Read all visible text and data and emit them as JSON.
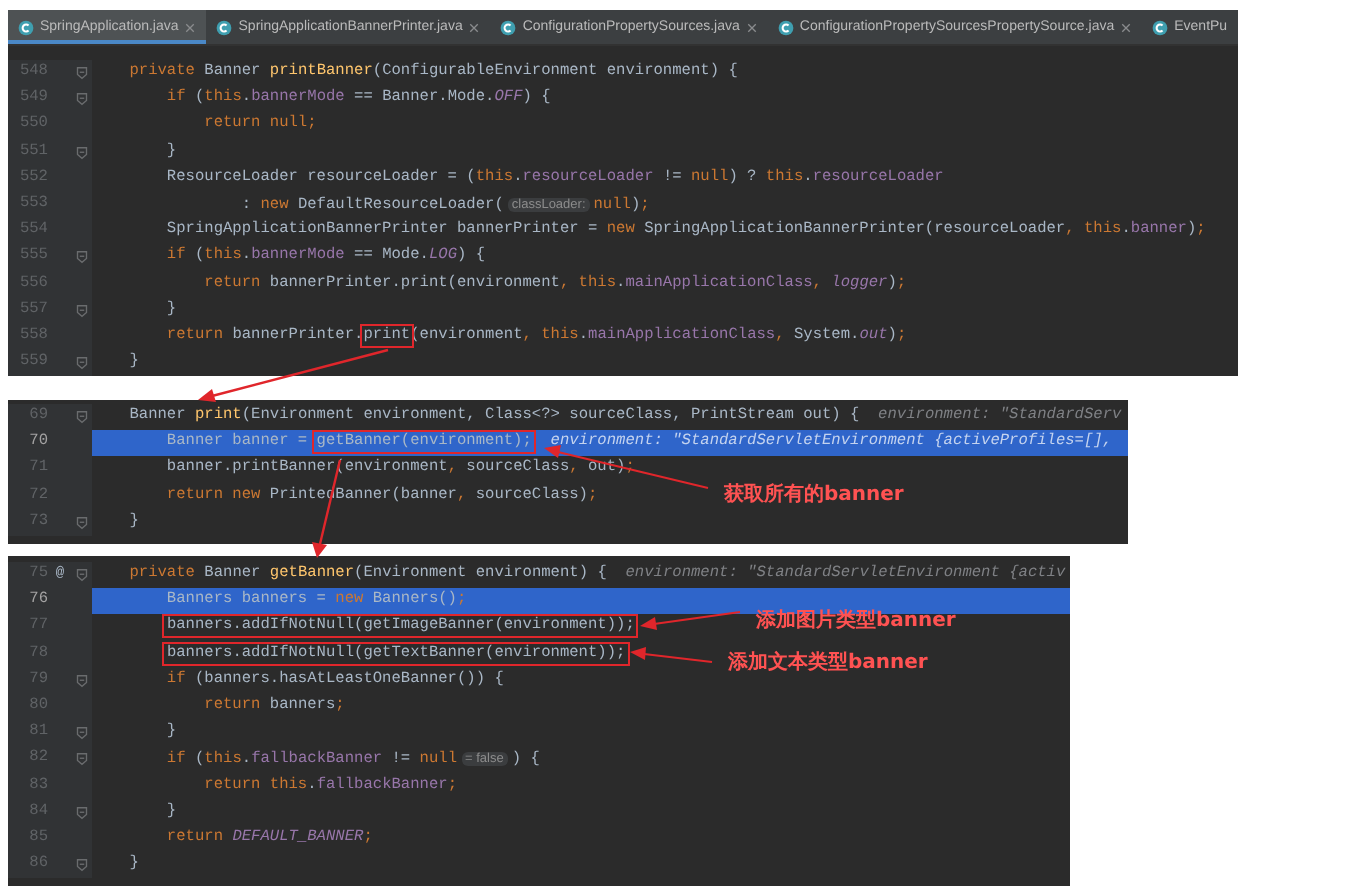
{
  "panels": [
    {
      "tabs": [
        {
          "label": "SpringApplication.java",
          "selected": true,
          "closable": true
        },
        {
          "label": "SpringApplicationBannerPrinter.java",
          "selected": false,
          "closable": true
        },
        {
          "label": "ConfigurationPropertySources.java",
          "selected": false,
          "closable": true
        },
        {
          "label": "ConfigurationPropertySourcesPropertySource.java",
          "selected": false,
          "closable": true
        },
        {
          "label": "EventPu",
          "selected": false,
          "closable": false
        }
      ],
      "lines": [
        {
          "number": "548",
          "fold": true,
          "selected": false,
          "tokens": [
            {
              "kind": "kw",
              "text": "    private "
            },
            {
              "kind": "plain",
              "text": "Banner "
            },
            {
              "kind": "method",
              "text": "printBanner"
            },
            {
              "kind": "plain",
              "text": "(ConfigurableEnvironment environment) {"
            }
          ]
        },
        {
          "number": "549",
          "fold": true,
          "selected": false,
          "tokens": [
            {
              "kind": "kw",
              "text": "        if "
            },
            {
              "kind": "plain",
              "text": "("
            },
            {
              "kind": "kw",
              "text": "this"
            },
            {
              "kind": "plain",
              "text": "."
            },
            {
              "kind": "field",
              "text": "bannerMode"
            },
            {
              "kind": "plain",
              "text": " == Banner.Mode."
            },
            {
              "kind": "const",
              "text": "OFF"
            },
            {
              "kind": "plain",
              "text": ") {"
            }
          ]
        },
        {
          "number": "550",
          "fold": false,
          "selected": false,
          "tokens": [
            {
              "kind": "kw",
              "text": "            return null;"
            }
          ]
        },
        {
          "number": "551",
          "fold": true,
          "selected": false,
          "tokens": [
            {
              "kind": "plain",
              "text": "        }"
            }
          ]
        },
        {
          "number": "552",
          "fold": false,
          "selected": false,
          "tokens": [
            {
              "kind": "plain",
              "text": "        ResourceLoader resourceLoader = ("
            },
            {
              "kind": "kw",
              "text": "this"
            },
            {
              "kind": "plain",
              "text": "."
            },
            {
              "kind": "field",
              "text": "resourceLoader"
            },
            {
              "kind": "plain",
              "text": " != "
            },
            {
              "kind": "kw",
              "text": "null"
            },
            {
              "kind": "plain",
              "text": ") ? "
            },
            {
              "kind": "kw",
              "text": "this"
            },
            {
              "kind": "plain",
              "text": "."
            },
            {
              "kind": "field",
              "text": "resourceLoader"
            }
          ]
        },
        {
          "number": "553",
          "fold": false,
          "selected": false,
          "tokens": [
            {
              "kind": "plain",
              "text": "                : "
            },
            {
              "kind": "kw",
              "text": "new "
            },
            {
              "kind": "plain",
              "text": "DefaultResourceLoader("
            },
            {
              "kind": "inlay",
              "text": "classLoader:"
            },
            {
              "kind": "kw",
              "text": "null"
            },
            {
              "kind": "plain",
              "text": ")"
            },
            {
              "kind": "kw",
              "text": ";"
            }
          ]
        },
        {
          "number": "554",
          "fold": false,
          "selected": false,
          "tokens": [
            {
              "kind": "plain",
              "text": "        SpringApplicationBannerPrinter bannerPrinter = "
            },
            {
              "kind": "kw",
              "text": "new "
            },
            {
              "kind": "plain",
              "text": "SpringApplicationBannerPrinter(resourceLoader"
            },
            {
              "kind": "kw",
              "text": ", this"
            },
            {
              "kind": "plain",
              "text": "."
            },
            {
              "kind": "field",
              "text": "banner"
            },
            {
              "kind": "plain",
              "text": ")"
            },
            {
              "kind": "kw",
              "text": ";"
            }
          ]
        },
        {
          "number": "555",
          "fold": true,
          "selected": false,
          "tokens": [
            {
              "kind": "kw",
              "text": "        if "
            },
            {
              "kind": "plain",
              "text": "("
            },
            {
              "kind": "kw",
              "text": "this"
            },
            {
              "kind": "plain",
              "text": "."
            },
            {
              "kind": "field",
              "text": "bannerMode"
            },
            {
              "kind": "plain",
              "text": " == Mode."
            },
            {
              "kind": "const",
              "text": "LOG"
            },
            {
              "kind": "plain",
              "text": ") {"
            }
          ]
        },
        {
          "number": "556",
          "fold": false,
          "selected": false,
          "tokens": [
            {
              "kind": "kw",
              "text": "            return "
            },
            {
              "kind": "plain",
              "text": "bannerPrinter.print(environment"
            },
            {
              "kind": "kw",
              "text": ", this"
            },
            {
              "kind": "plain",
              "text": "."
            },
            {
              "kind": "field",
              "text": "mainApplicationClass"
            },
            {
              "kind": "kw",
              "text": ", "
            },
            {
              "kind": "const",
              "text": "logger"
            },
            {
              "kind": "plain",
              "text": ")"
            },
            {
              "kind": "kw",
              "text": ";"
            }
          ]
        },
        {
          "number": "557",
          "fold": true,
          "selected": false,
          "tokens": [
            {
              "kind": "plain",
              "text": "        }"
            }
          ]
        },
        {
          "number": "558",
          "fold": false,
          "selected": false,
          "tokens": [
            {
              "kind": "kw",
              "text": "        return "
            },
            {
              "kind": "plain",
              "text": "bannerPrinter."
            },
            {
              "kind": "plain",
              "text": "print",
              "boxed": true
            },
            {
              "kind": "plain",
              "text": "(environment"
            },
            {
              "kind": "kw",
              "text": ", this"
            },
            {
              "kind": "plain",
              "text": "."
            },
            {
              "kind": "field",
              "text": "mainApplicationClass"
            },
            {
              "kind": "kw",
              "text": ", "
            },
            {
              "kind": "plain",
              "text": "System."
            },
            {
              "kind": "const",
              "text": "out"
            },
            {
              "kind": "plain",
              "text": ")"
            },
            {
              "kind": "kw",
              "text": ";"
            }
          ]
        },
        {
          "number": "559",
          "fold": true,
          "selected": false,
          "tokens": [
            {
              "kind": "plain",
              "text": "    }"
            }
          ]
        }
      ]
    },
    {
      "lines": [
        {
          "number": "69",
          "fold": true,
          "selected": false,
          "tokens": [
            {
              "kind": "plain",
              "text": "    Banner "
            },
            {
              "kind": "method",
              "text": "print"
            },
            {
              "kind": "plain",
              "text": "(Environment environment, Class<?> sourceClass, PrintStream out) {"
            },
            {
              "kind": "debug",
              "text": "  environment: \"StandardServ"
            }
          ]
        },
        {
          "number": "70",
          "fold": false,
          "selected": true,
          "tokens": [
            {
              "kind": "plain",
              "text": "        Banner banner = "
            },
            {
              "kind": "plain",
              "text": "getBanner(environment);",
              "boxed": true
            },
            {
              "kind": "debug",
              "text": "  environment: \"StandardServletEnvironment {activeProfiles=[],"
            }
          ]
        },
        {
          "number": "71",
          "fold": false,
          "selected": false,
          "tokens": [
            {
              "kind": "plain",
              "text": "        banner.printBanner(environment"
            },
            {
              "kind": "kw",
              "text": ", "
            },
            {
              "kind": "plain",
              "text": "sourceClass"
            },
            {
              "kind": "kw",
              "text": ", "
            },
            {
              "kind": "plain",
              "text": "out)"
            },
            {
              "kind": "kw",
              "text": ";"
            }
          ]
        },
        {
          "number": "72",
          "fold": false,
          "selected": false,
          "tokens": [
            {
              "kind": "kw",
              "text": "        return new "
            },
            {
              "kind": "plain",
              "text": "PrintedBanner(banner"
            },
            {
              "kind": "kw",
              "text": ", "
            },
            {
              "kind": "plain",
              "text": "sourceClass)"
            },
            {
              "kind": "kw",
              "text": ";"
            }
          ]
        },
        {
          "number": "73",
          "fold": true,
          "selected": false,
          "tokens": [
            {
              "kind": "plain",
              "text": "    }"
            }
          ]
        }
      ],
      "notes": [
        {
          "text": "获取所有的banner"
        }
      ]
    },
    {
      "lines": [
        {
          "number": "75",
          "mark": "@",
          "fold": true,
          "selected": false,
          "tokens": [
            {
              "kind": "kw",
              "text": "    private "
            },
            {
              "kind": "plain",
              "text": "Banner "
            },
            {
              "kind": "method",
              "text": "getBanner"
            },
            {
              "kind": "plain",
              "text": "(Environment environment) {"
            },
            {
              "kind": "debug",
              "text": "  environment: \"StandardServletEnvironment {activ"
            }
          ]
        },
        {
          "number": "76",
          "fold": false,
          "selected": true,
          "tokens": [
            {
              "kind": "plain",
              "text": "        Banners banners = "
            },
            {
              "kind": "kw",
              "text": "new "
            },
            {
              "kind": "plain",
              "text": "Banners()"
            },
            {
              "kind": "kw",
              "text": ";"
            }
          ]
        },
        {
          "number": "77",
          "fold": false,
          "selected": false,
          "tokens": [
            {
              "kind": "plain",
              "text": "        banners.addIfNotNull(getImageBanner(environment));",
              "boxed": true
            }
          ]
        },
        {
          "number": "78",
          "fold": false,
          "selected": false,
          "tokens": [
            {
              "kind": "plain",
              "text": "        banners.addIfNotNull(getTextBanner(environment));",
              "boxed": true
            }
          ]
        },
        {
          "number": "79",
          "fold": true,
          "selected": false,
          "tokens": [
            {
              "kind": "kw",
              "text": "        if "
            },
            {
              "kind": "plain",
              "text": "(banners.hasAtLeastOneBanner()) {"
            }
          ]
        },
        {
          "number": "80",
          "fold": false,
          "selected": false,
          "tokens": [
            {
              "kind": "kw",
              "text": "            return "
            },
            {
              "kind": "plain",
              "text": "banners"
            },
            {
              "kind": "kw",
              "text": ";"
            }
          ]
        },
        {
          "number": "81",
          "fold": true,
          "selected": false,
          "tokens": [
            {
              "kind": "plain",
              "text": "        }"
            }
          ]
        },
        {
          "number": "82",
          "fold": true,
          "selected": false,
          "tokens": [
            {
              "kind": "kw",
              "text": "        if "
            },
            {
              "kind": "plain",
              "text": "("
            },
            {
              "kind": "kw",
              "text": "this"
            },
            {
              "kind": "plain",
              "text": "."
            },
            {
              "kind": "field",
              "text": "fallbackBanner"
            },
            {
              "kind": "plain",
              "text": " != "
            },
            {
              "kind": "kw",
              "text": "null"
            },
            {
              "kind": "inlay",
              "text": "= false"
            },
            {
              "kind": "plain",
              "text": ") {"
            }
          ]
        },
        {
          "number": "83",
          "fold": false,
          "selected": false,
          "tokens": [
            {
              "kind": "kw",
              "text": "            return this"
            },
            {
              "kind": "plain",
              "text": "."
            },
            {
              "kind": "field",
              "text": "fallbackBanner"
            },
            {
              "kind": "kw",
              "text": ";"
            }
          ]
        },
        {
          "number": "84",
          "fold": true,
          "selected": false,
          "tokens": [
            {
              "kind": "plain",
              "text": "        }"
            }
          ]
        },
        {
          "number": "85",
          "fold": false,
          "selected": false,
          "tokens": [
            {
              "kind": "kw",
              "text": "        return "
            },
            {
              "kind": "const",
              "text": "DEFAULT_BANNER"
            },
            {
              "kind": "kw",
              "text": ";"
            }
          ]
        },
        {
          "number": "86",
          "fold": true,
          "selected": false,
          "tokens": [
            {
              "kind": "plain",
              "text": "    }"
            }
          ]
        }
      ],
      "notes": [
        {
          "text": "添加图片类型banner"
        },
        {
          "text": "添加文本类型banner"
        }
      ]
    }
  ]
}
